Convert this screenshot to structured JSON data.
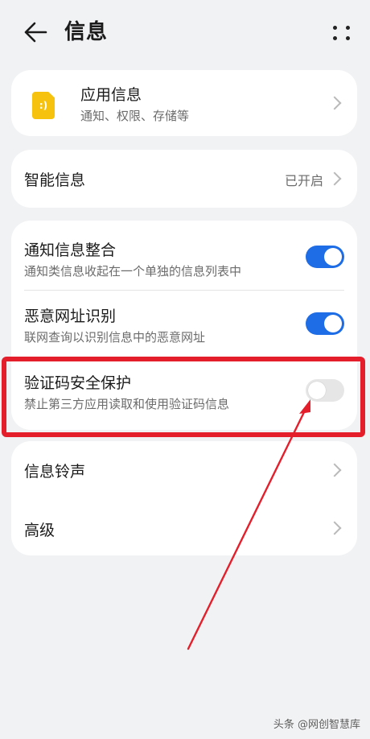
{
  "header": {
    "title": "信息"
  },
  "app_info": {
    "title": "应用信息",
    "subtitle": "通知、权限、存储等"
  },
  "smart_info": {
    "title": "智能信息",
    "value": "已开启"
  },
  "toggles": [
    {
      "title": "通知信息整合",
      "subtitle": "通知类信息收起在一个单独的信息列表中",
      "on": true
    },
    {
      "title": "恶意网址识别",
      "subtitle": "联网查询以识别信息中的恶意网址",
      "on": true
    },
    {
      "title": "验证码安全保护",
      "subtitle": "禁止第三方应用读取和使用验证码信息",
      "on": false
    }
  ],
  "more_items": [
    {
      "title": "信息铃声"
    },
    {
      "title": "高级"
    }
  ],
  "watermark": "头条 @网创智慧库",
  "colors": {
    "toggle_on": "#1e6ce6",
    "highlight": "#e41f2b",
    "app_icon": "#f7c20e"
  }
}
